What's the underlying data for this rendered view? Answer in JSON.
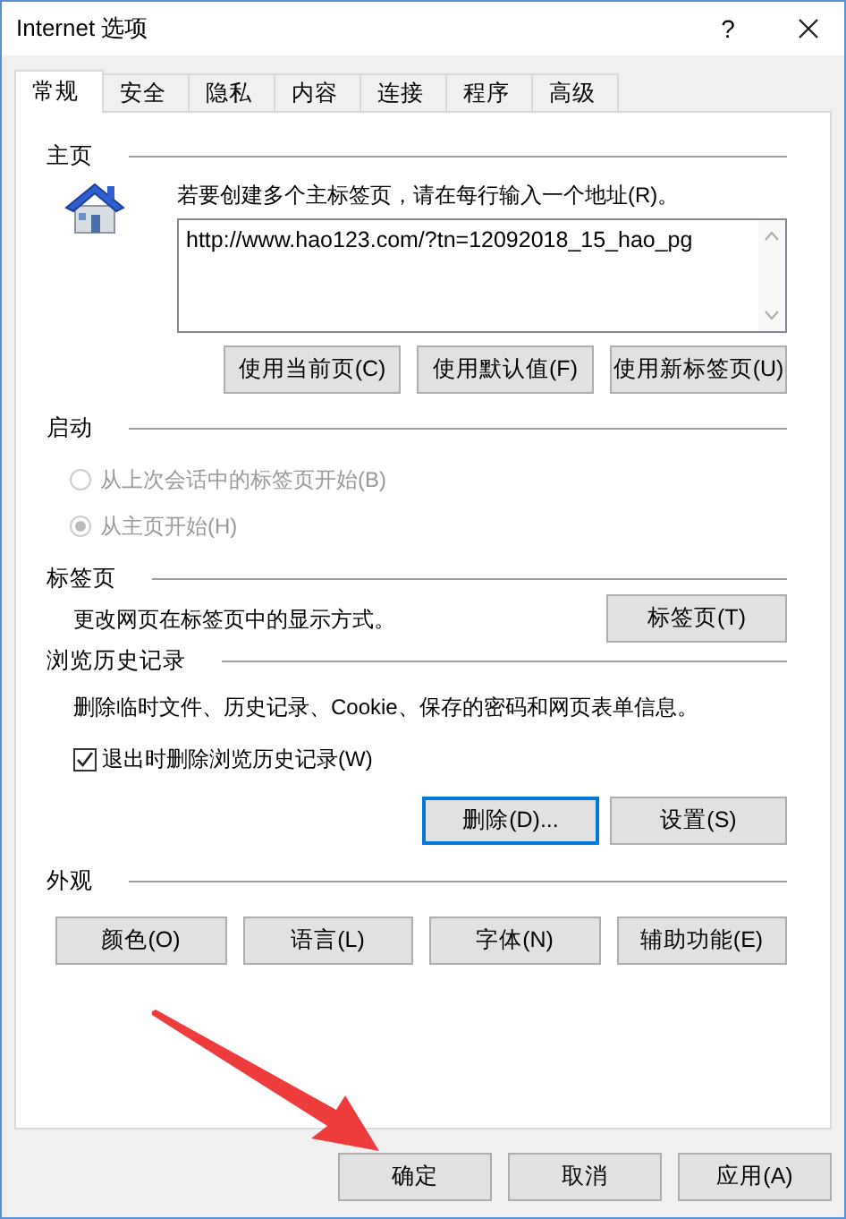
{
  "window": {
    "title": "Internet 选项",
    "help": "?"
  },
  "tabs": [
    {
      "label": "常规",
      "selected": true
    },
    {
      "label": "安全",
      "selected": false
    },
    {
      "label": "隐私",
      "selected": false
    },
    {
      "label": "内容",
      "selected": false
    },
    {
      "label": "连接",
      "selected": false
    },
    {
      "label": "程序",
      "selected": false
    },
    {
      "label": "高级",
      "selected": false
    }
  ],
  "home_page": {
    "heading": "主页",
    "hint": "若要创建多个主标签页，请在每行输入一个地址(R)。",
    "value": "http://www.hao123.com/?tn=12092018_15_hao_pg",
    "buttons": [
      "使用当前页(C)",
      "使用默认值(F)",
      "使用新标签页(U)"
    ]
  },
  "startup": {
    "heading": "启动",
    "options": [
      {
        "label": "从上次会话中的标签页开始(B)",
        "selected": false,
        "disabled": true
      },
      {
        "label": "从主页开始(H)",
        "selected": true,
        "disabled": true
      }
    ]
  },
  "tabs_section": {
    "heading": "标签页",
    "description": "更改网页在标签页中的显示方式。",
    "button": "标签页(T)"
  },
  "history": {
    "heading": "浏览历史记录",
    "description": "删除临时文件、历史记录、Cookie、保存的密码和网页表单信息。",
    "checkbox": {
      "label": "退出时删除浏览历史记录(W)",
      "checked": true
    },
    "buttons": [
      {
        "label": "删除(D)...",
        "focused": true
      },
      {
        "label": "设置(S)",
        "focused": false
      }
    ]
  },
  "appearance": {
    "heading": "外观",
    "buttons": [
      "颜色(O)",
      "语言(L)",
      "字体(N)",
      "辅助功能(E)"
    ]
  },
  "footer": {
    "buttons": [
      "确定",
      "取消",
      "应用(A)"
    ]
  }
}
